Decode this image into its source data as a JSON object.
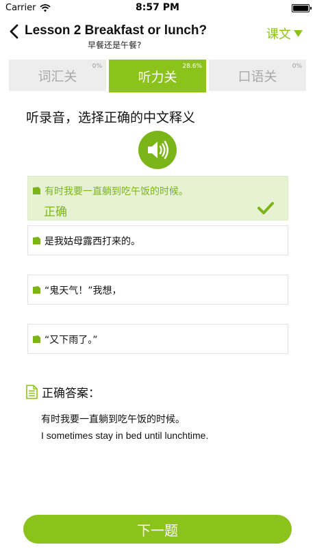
{
  "status_bar": {
    "carrier": "Carrier",
    "time": "8:57 PM"
  },
  "nav": {
    "title": "Lesson 2 Breakfast or lunch?",
    "subtitle": "早餐还是午餐?",
    "text_button": "课文"
  },
  "tabs": [
    {
      "label": "词汇关",
      "percent": "0%",
      "active": false
    },
    {
      "label": "听力关",
      "percent": "28.6%",
      "active": true
    },
    {
      "label": "口语关",
      "percent": "0%",
      "active": false
    }
  ],
  "question": "听录音，选择正确的中文释义",
  "options": [
    {
      "text": "有时我要一直躺到吃午饭的时候。",
      "correct": true
    },
    {
      "text": "是我姑母露西打来的。",
      "correct": false
    },
    {
      "text": "“鬼天气！”我想，",
      "correct": false
    },
    {
      "text": "“又下雨了。”",
      "correct": false
    }
  ],
  "correct_label": "正确",
  "answer": {
    "title": "正确答案：",
    "chinese": "有时我要一直躺到吃午饭的时候。",
    "english": "I sometimes stay in bed until lunchtime."
  },
  "next_button": "下一题",
  "icons": {
    "back": "chevron-left-icon",
    "dropdown": "triangle-down-icon",
    "audio": "speaker-icon",
    "bullet": "tag-icon",
    "check": "check-icon",
    "answer": "document-icon"
  },
  "colors": {
    "accent": "#8cc21c",
    "correct_bg": "#e6f2d2",
    "tab_bg": "#ededed"
  }
}
